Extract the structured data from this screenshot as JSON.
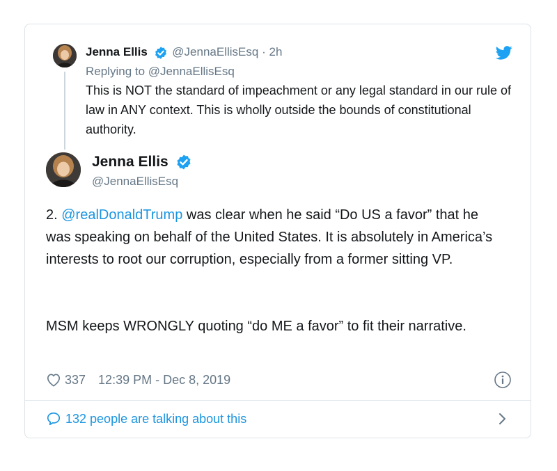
{
  "reply": {
    "author_name": "Jenna Ellis",
    "handle": "@JennaEllisEsq",
    "separator": "·",
    "time_ago": "2h",
    "replying_prefix": "Replying to",
    "replying_to": "@JennaEllisEsq",
    "text": "This is NOT the standard of impeachment or any legal standard in our rule of law in ANY context. This is wholly outside the bounds of constitutional authority."
  },
  "main": {
    "author_name": "Jenna Ellis",
    "handle": "@JennaEllisEsq",
    "text_prefix": "2. ",
    "mention": "@realDonaldTrump",
    "text_after_mention": " was clear when he said “Do US a favor” that he was speaking on behalf of the United States. It is absolutely in America’s interests to root our corruption, especially from a former sitting VP.",
    "text_paragraph2": "MSM keeps WRONGLY quoting “do ME a favor” to fit their narrative.",
    "likes": "337",
    "timestamp": "12:39 PM - Dec 8, 2019"
  },
  "footer": {
    "talking_label": "132 people are talking about this"
  },
  "colors": {
    "link": "#1b95e0",
    "muted": "#657786",
    "verified": "#1da1f2",
    "border": "#dde3e7"
  },
  "icons": {
    "brand": "twitter-bird-icon",
    "verified": "verified-badge-icon",
    "like": "heart-outline-icon",
    "info": "info-icon",
    "reply_bubble": "speech-bubble-icon",
    "chevron": "chevron-right-icon"
  }
}
